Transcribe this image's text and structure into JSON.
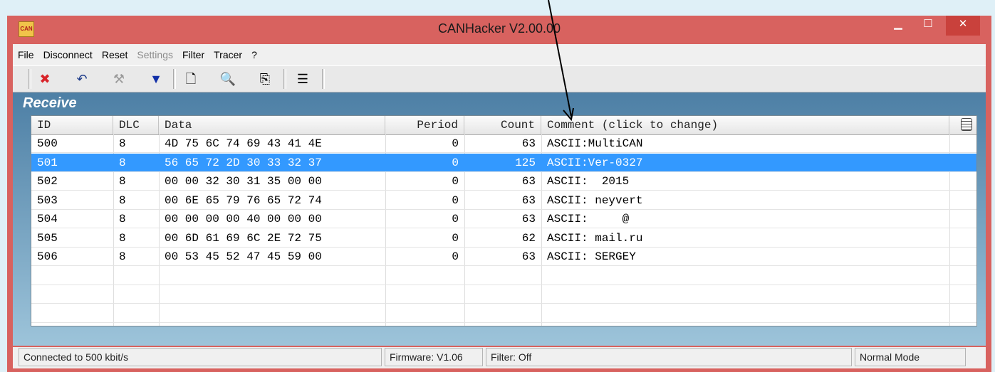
{
  "window": {
    "title": "CANHacker V2.00.00",
    "app_icon_text": "CAN",
    "minimize_glyph": "▁",
    "maximize_glyph": "☐",
    "close_glyph": "✕"
  },
  "menu": [
    "File",
    "Disconnect",
    "Reset",
    "Settings",
    "Filter",
    "Tracer",
    "?"
  ],
  "menu_disabled": [
    "Settings"
  ],
  "toolbar": {
    "icons": [
      "disconnect-icon",
      "undo-icon",
      "tools-icon",
      "filter-icon",
      "new-file-icon",
      "preview-icon",
      "copy-icon",
      "list-icon"
    ],
    "glyphs": [
      "✖",
      "↶",
      "⚒",
      "▼",
      "🗋",
      "🔍",
      "⎘",
      "☰"
    ]
  },
  "receive": {
    "label": "Receive",
    "columns": {
      "id": "ID",
      "dlc": "DLC",
      "data": "Data",
      "period": "Period",
      "count": "Count",
      "comment": "Comment (click to change)"
    },
    "rows": [
      {
        "id": "500",
        "dlc": "8",
        "data": "4D 75 6C 74 69 43 41 4E",
        "period": "0",
        "count": "63",
        "comment": "ASCII:MultiCAN"
      },
      {
        "id": "501",
        "dlc": "8",
        "data": "56 65 72 2D 30 33 32 37",
        "period": "0",
        "count": "125",
        "comment": "ASCII:Ver-0327"
      },
      {
        "id": "502",
        "dlc": "8",
        "data": "00 00 32 30 31 35 00 00",
        "period": "0",
        "count": "63",
        "comment": "ASCII:  2015"
      },
      {
        "id": "503",
        "dlc": "8",
        "data": "00 6E 65 79 76 65 72 74",
        "period": "0",
        "count": "63",
        "comment": "ASCII: neyvert"
      },
      {
        "id": "504",
        "dlc": "8",
        "data": "00 00 00 00 40 00 00 00",
        "period": "0",
        "count": "63",
        "comment": "ASCII:     @"
      },
      {
        "id": "505",
        "dlc": "8",
        "data": "00 6D 61 69 6C 2E 72 75",
        "period": "0",
        "count": "62",
        "comment": "ASCII: mail.ru"
      },
      {
        "id": "506",
        "dlc": "8",
        "data": "00 53 45 52 47 45 59 00",
        "period": "0",
        "count": "63",
        "comment": "ASCII: SERGEY"
      }
    ],
    "selected_row_index": 1
  },
  "status": {
    "connection": "Connected to 500 kbit/s",
    "firmware": "Firmware: V1.06",
    "filter": "Filter: Off",
    "mode": "Normal Mode"
  },
  "colors": {
    "titlebar": "#d8625f",
    "selection": "#3399ff",
    "annotation_arrow": "#000000"
  }
}
